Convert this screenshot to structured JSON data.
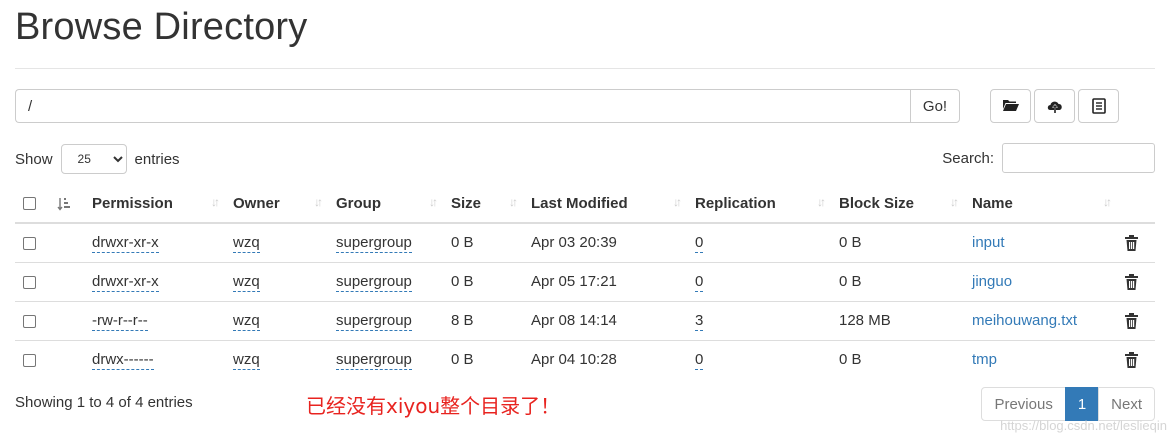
{
  "page": {
    "title": "Browse Directory"
  },
  "path_bar": {
    "value": "/",
    "go_label": "Go!"
  },
  "toolbar": {
    "buttons": [
      {
        "icon": "folder-open-icon"
      },
      {
        "icon": "cloud-upload-icon"
      },
      {
        "icon": "list-icon"
      }
    ]
  },
  "controls": {
    "show_label": "Show",
    "entries_label": "entries",
    "page_size": "25",
    "search_label": "Search:",
    "search_value": ""
  },
  "table": {
    "headers": [
      "Permission",
      "Owner",
      "Group",
      "Size",
      "Last Modified",
      "Replication",
      "Block Size",
      "Name"
    ],
    "rows": [
      {
        "permission": "drwxr-xr-x",
        "owner": "wzq",
        "group": "supergroup",
        "size": "0 B",
        "modified": "Apr 03 20:39",
        "replication": "0",
        "block_size": "0 B",
        "name": "input"
      },
      {
        "permission": "drwxr-xr-x",
        "owner": "wzq",
        "group": "supergroup",
        "size": "0 B",
        "modified": "Apr 05 17:21",
        "replication": "0",
        "block_size": "0 B",
        "name": "jinguo"
      },
      {
        "permission": "-rw-r--r--",
        "owner": "wzq",
        "group": "supergroup",
        "size": "8 B",
        "modified": "Apr 08 14:14",
        "replication": "3",
        "block_size": "128 MB",
        "name": "meihouwang.txt"
      },
      {
        "permission": "drwx------",
        "owner": "wzq",
        "group": "supergroup",
        "size": "0 B",
        "modified": "Apr 04 10:28",
        "replication": "0",
        "block_size": "0 B",
        "name": "tmp"
      }
    ]
  },
  "footer": {
    "info": "Showing 1 to 4 of 4 entries",
    "annotation": "已经没有xiyou整个目录了！",
    "pagination": {
      "previous": "Previous",
      "current": "1",
      "next": "Next"
    },
    "watermark": "https://blog.csdn.net/leslieqin"
  },
  "colors": {
    "link": "#337ab7",
    "annotation": "#e8231f",
    "active_page": "#337ab7"
  }
}
